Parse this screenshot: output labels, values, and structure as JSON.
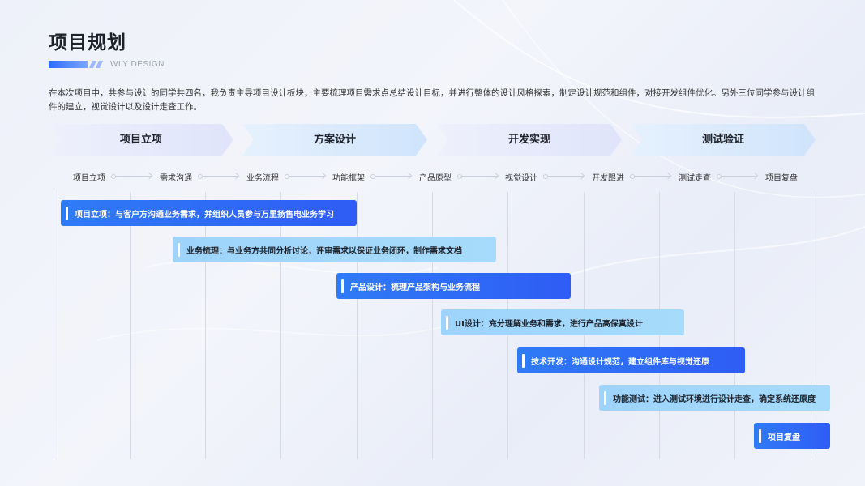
{
  "header": {
    "title": "项目规划",
    "subtitle": "WLY DESIGN",
    "description": "在本次项目中，共参与设计的同学共四名，我负责主导项目设计板块，主要梳理项目需求点总结设计目标，并进行整体的设计风格探索，制定设计规范和组件，对接开发组件优化。另外三位同学参与设计组件的建立，视觉设计以及设计走查工作。"
  },
  "phases": [
    {
      "label": "项目立项"
    },
    {
      "label": "方案设计"
    },
    {
      "label": "开发实现"
    },
    {
      "label": "测试验证"
    }
  ],
  "steps": [
    "项目立项",
    "需求沟通",
    "业务流程",
    "功能框架",
    "产品原型",
    "视觉设计",
    "开发跟进",
    "测试走查",
    "项目复盘"
  ],
  "tasks": [
    {
      "label": "项目立项：与客户方沟通业务需求，并组织人员参与万里扬售电业务学习",
      "style": "dark"
    },
    {
      "label": "业务梳理：与业务方共同分析讨论，评审需求以保证业务闭环，制作需求文档",
      "style": "light"
    },
    {
      "label": "产品设计：梳理产品架构与业务流程",
      "style": "dark"
    },
    {
      "label": "UI设计：充分理解业务和需求，进行产品高保真设计",
      "style": "light"
    },
    {
      "label": "技术开发：沟通设计规范，建立组件库与视觉还原",
      "style": "dark"
    },
    {
      "label": "功能测试：进入测试环境进行设计走查，确定系统还原度",
      "style": "light"
    },
    {
      "label": "项目复盘",
      "style": "dark"
    }
  ],
  "colors": {
    "accent": "#2f6bff",
    "task_dark": "#2f6bf6",
    "task_light": "#a3d8fb",
    "phase_fill_light": "#e4e8fb",
    "phase_fill_blue": "#d3e6fc"
  }
}
